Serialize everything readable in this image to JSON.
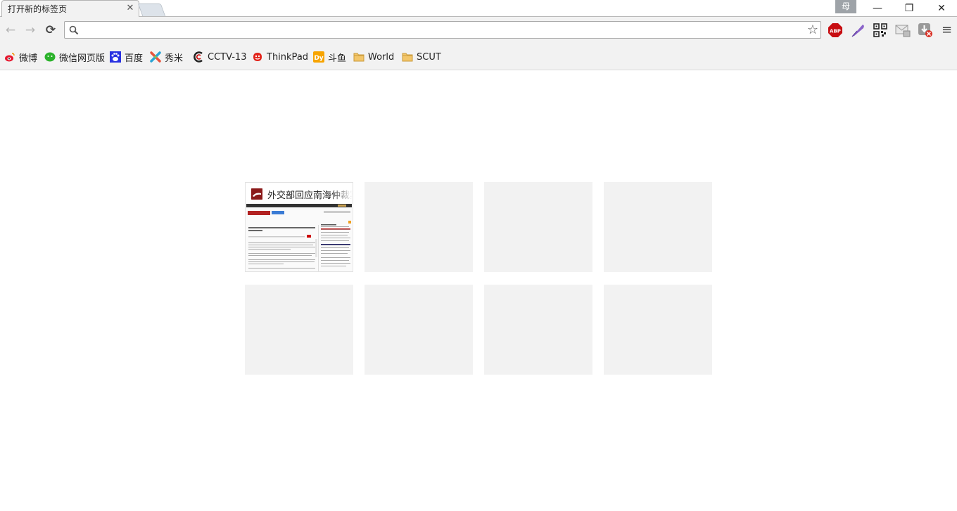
{
  "tab": {
    "title": "打开新的标签页",
    "close": "✕"
  },
  "window": {
    "profile_label": "母",
    "minimize": "—",
    "restore": "❐",
    "close": "✕"
  },
  "toolbar": {
    "back": "←",
    "forward": "→",
    "reload": "⟳",
    "address_value": "",
    "address_placeholder": "",
    "star": "☆",
    "menu": "≡"
  },
  "extensions": [
    "abp-icon",
    "quill-icon",
    "qr-code-icon",
    "mail-icon",
    "download-icon"
  ],
  "bookmarks": [
    {
      "label": "微博",
      "icon": "weibo-icon"
    },
    {
      "label": "微信网页版",
      "icon": "wechat-icon"
    },
    {
      "label": "百度",
      "icon": "baidu-icon"
    },
    {
      "label": "秀米",
      "icon": "xiumi-icon"
    },
    {
      "label": "CCTV-13",
      "icon": "cctv-icon"
    },
    {
      "label": "ThinkPad",
      "icon": "thinkpad-icon"
    },
    {
      "label": "斗鱼",
      "icon": "douyu-icon"
    },
    {
      "label": "World",
      "icon": "folder-icon"
    },
    {
      "label": "SCUT",
      "icon": "folder-icon"
    }
  ],
  "most_visited": [
    {
      "title": "外交部回应南海仲裁案",
      "filled": true
    },
    {
      "title": "",
      "filled": false
    },
    {
      "title": "",
      "filled": false
    },
    {
      "title": "",
      "filled": false
    },
    {
      "title": "",
      "filled": false
    },
    {
      "title": "",
      "filled": false
    },
    {
      "title": "",
      "filled": false
    },
    {
      "title": "",
      "filled": false
    }
  ],
  "colors": {
    "chrome_bg": "#f2f2f2",
    "tile_empty": "#f2f2f2",
    "abp_red": "#c70d11",
    "accent": "#8b1a1a"
  }
}
